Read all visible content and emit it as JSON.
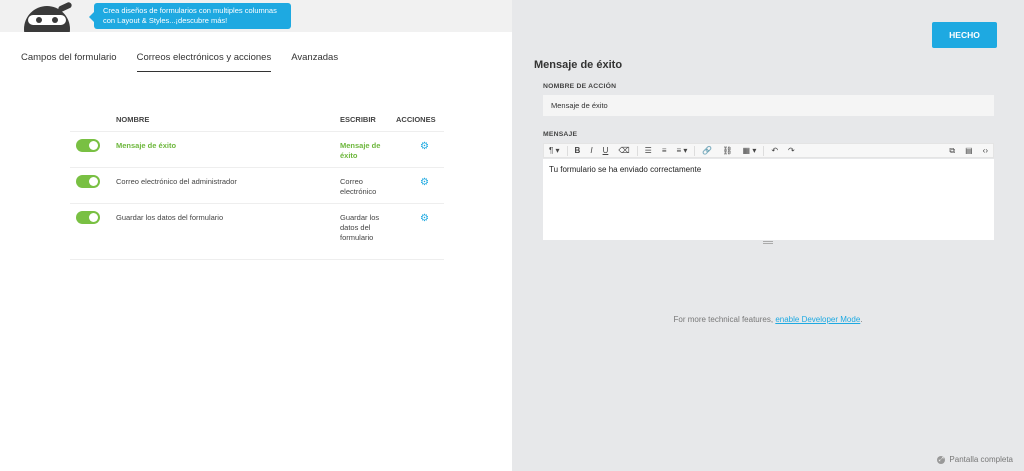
{
  "tooltip": {
    "line1": "Crea diseños de formularios con multiples columnas",
    "line2": "con Layout & Styles...¡descubre más!"
  },
  "tabs": [
    {
      "label": "Campos del formulario",
      "active": false
    },
    {
      "label": "Correos electrónicos y acciones",
      "active": true
    },
    {
      "label": "Avanzadas",
      "active": false
    }
  ],
  "table": {
    "headers": {
      "name": "NOMBRE",
      "write": "ESCRIBIR",
      "actions": "ACCIONES"
    },
    "rows": [
      {
        "enabled": true,
        "name": "Mensaje de éxito",
        "write": "Mensaje de éxito",
        "highlight": true
      },
      {
        "enabled": true,
        "name": "Correo electrónico del administrador",
        "write": "Correo electrónico",
        "highlight": false
      },
      {
        "enabled": true,
        "name": "Guardar los datos del formulario",
        "write": "Guardar los datos del formulario",
        "highlight": false
      }
    ]
  },
  "right": {
    "done_label": "HECHO",
    "title": "Mensaje de éxito",
    "action_name_label": "NOMBRE DE ACCIÓN",
    "action_name_value": "Mensaje de éxito",
    "message_label": "MENSAJE",
    "message_value": "Tu formulario se ha enviado correctamente",
    "dev_note_prefix": "For more technical features,",
    "dev_note_link": "enable Developer Mode",
    "dev_note_suffix": ".",
    "fullscreen_label": "Pantalla completa"
  },
  "colors": {
    "accent": "#1ea9e1",
    "toggle_on": "#79c043",
    "success": "#6db73c"
  }
}
